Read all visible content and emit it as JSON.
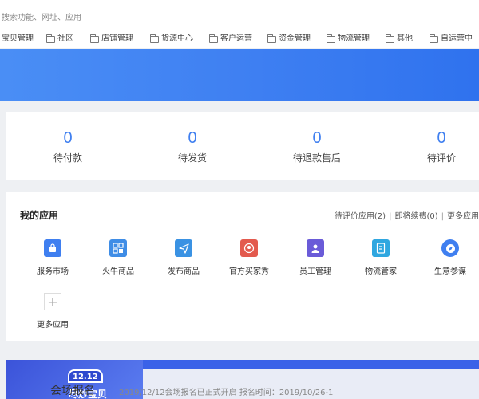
{
  "search": {
    "placeholder": "搜索功能、网址、应用"
  },
  "bookmarks": [
    "宝贝管理",
    "社区",
    "店铺管理",
    "货源中心",
    "客户运营",
    "资金管理",
    "物流管理",
    "其他",
    "自运营中"
  ],
  "stats": [
    {
      "value": "0",
      "label": "待付款"
    },
    {
      "value": "0",
      "label": "待发货"
    },
    {
      "value": "0",
      "label": "待退款售后"
    },
    {
      "value": "0",
      "label": "待评价"
    }
  ],
  "apps": {
    "title": "我的应用",
    "links": [
      "待评价应用(2)",
      "即将续费(0)",
      "更多应用"
    ],
    "items": [
      {
        "label": "服务市场",
        "icon": "shopping-bag-icon",
        "color": "#3f7ff0"
      },
      {
        "label": "火牛商品",
        "icon": "grid-icon",
        "color": "#3f8de6"
      },
      {
        "label": "发布商品",
        "icon": "paper-plane-icon",
        "color": "#3a92e3"
      },
      {
        "label": "官方买家秀",
        "icon": "buyer-show-icon",
        "color": "#e35a4e"
      },
      {
        "label": "员工管理",
        "icon": "employee-icon",
        "color": "#6a5bd8"
      },
      {
        "label": "物流管家",
        "icon": "logistics-icon",
        "color": "#2fa7e0"
      },
      {
        "label": "生意参谋",
        "icon": "compass-icon",
        "color": "#3f7ff0"
      }
    ],
    "more": {
      "label": "更多应用",
      "icon": "plus-icon"
    }
  },
  "promo": {
    "badge_number": "12.12",
    "badge_text": "尽炒宝贝",
    "title": "会场报名",
    "desc": "2019/12/12会场报名已正式开启 报名时间：2019/10/26-1"
  }
}
